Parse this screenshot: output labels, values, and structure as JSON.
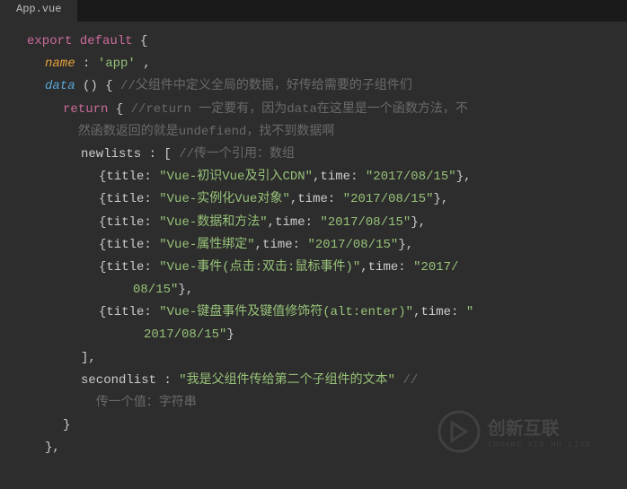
{
  "tab": {
    "filename": "App.vue"
  },
  "code": {
    "kw_export": "export",
    "kw_default": "default",
    "brace_open": " {",
    "name_key": "name",
    "colon": ": ",
    "name_val": "'app'",
    "comma": ",",
    "data_key": "data",
    "data_parens": " ()",
    "comment_data": "//父组件中定义全局的数据，好传给需要的子组件们",
    "kw_return": "return",
    "comment_return": "//return 一定要有，因为data在这里是一个函数方法，不然函数返回的就是undefiend，找不到数据啊",
    "newlists_key": "newlists",
    "bracket_open": ": [",
    "comment_newlists": "//传一个引用：数组",
    "items": [
      {
        "title_key": "title",
        "title_val": "\"Vue-初识Vue及引入CDN\"",
        "time_key": "time",
        "time_val": "\"2017/08/15\""
      },
      {
        "title_key": "title",
        "title_val": "\"Vue-实例化Vue对象\"",
        "time_key": "time",
        "time_val": "\"2017/08/15\""
      },
      {
        "title_key": "title",
        "title_val": "\"Vue-数据和方法\"",
        "time_key": "time",
        "time_val": "\"2017/08/15\""
      },
      {
        "title_key": "title",
        "title_val": "\"Vue-属性绑定\"",
        "time_key": "time",
        "time_val": "\"2017/08/15\""
      },
      {
        "title_key": "title",
        "title_val": "\"Vue-事件(点击:双击:鼠标事件)\"",
        "time_key": "time",
        "time_val": "\"2017/08/15\""
      },
      {
        "title_key": "title",
        "title_val": "\"Vue-键盘事件及键值修饰符(alt:enter)\"",
        "time_key": "time",
        "time_val": "\"2017/08/15\""
      }
    ],
    "obj_open": "{",
    "obj_close": "}",
    "bracket_close": "],",
    "secondlist_key": "secondlist",
    "secondlist_val": "\"我是父组件传给第二个子组件的文本\"",
    "comment_secondlist": "//传一个值：字符串",
    "brace_close": "}",
    "brace_close_comma": "},"
  },
  "watermark": {
    "title": "创新互联",
    "sub": "CHUANG XIN HU LIAN"
  }
}
